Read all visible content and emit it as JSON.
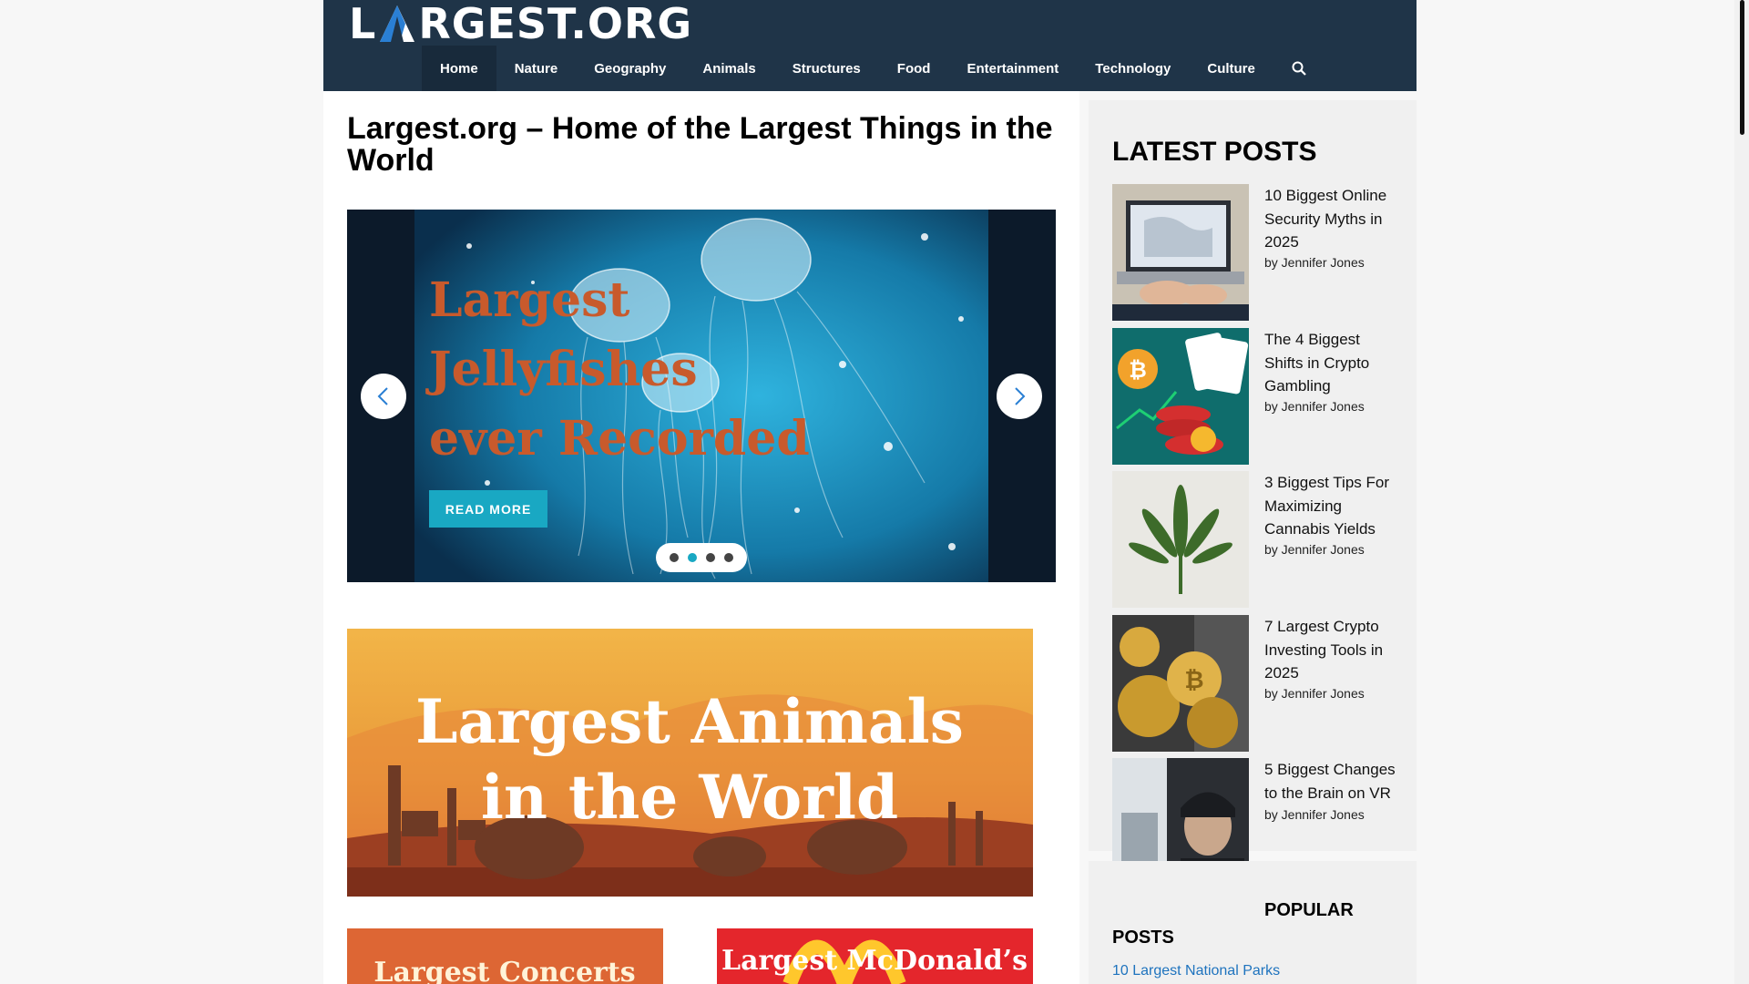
{
  "header": {
    "logo_text": "RGEST.ORG",
    "logo_letter": "L",
    "nav": [
      "Home",
      "Nature",
      "Geography",
      "Animals",
      "Structures",
      "Food",
      "Entertainment",
      "Technology",
      "Culture"
    ],
    "active_nav": "Home",
    "search_icon": "search-icon"
  },
  "main": {
    "title": "Largest.org – Home of the Largest Things in the World",
    "slider": {
      "slide_title": "Largest Jellyfishes ever Recorded",
      "read_more": "READ MORE",
      "active_dot": 2,
      "dot_count": 4
    },
    "banner_animals": {
      "line1": "Largest Animals",
      "line2": "in the World"
    },
    "banner_concerts": "Largest Concerts",
    "banner_mcdonalds": "Largest McDonald’s"
  },
  "sidebar": {
    "latest_title": "LATEST POSTS",
    "posts": [
      {
        "title": "10 Biggest Online Security Myths in 2025",
        "author": "by Jennifer Jones"
      },
      {
        "title": "The 4 Biggest Shifts in Crypto Gambling",
        "author": "by Jennifer Jones"
      },
      {
        "title": "3 Biggest Tips For Maximizing Cannabis Yields",
        "author": "by Jennifer Jones"
      },
      {
        "title": "7 Largest Crypto Investing Tools in 2025",
        "author": "by Jennifer Jones"
      },
      {
        "title": "5 Biggest Changes to the Brain on VR",
        "author": "by Jennifer Jones"
      }
    ],
    "popular_title_1": "POPULAR",
    "popular_title_2": "POSTS",
    "popular_first": "10 Largest National Parks"
  },
  "colors": {
    "header_bg": "#1f3448",
    "accent": "#19a8c3",
    "slide_title": "#c85a2c",
    "link": "#1e73be"
  }
}
